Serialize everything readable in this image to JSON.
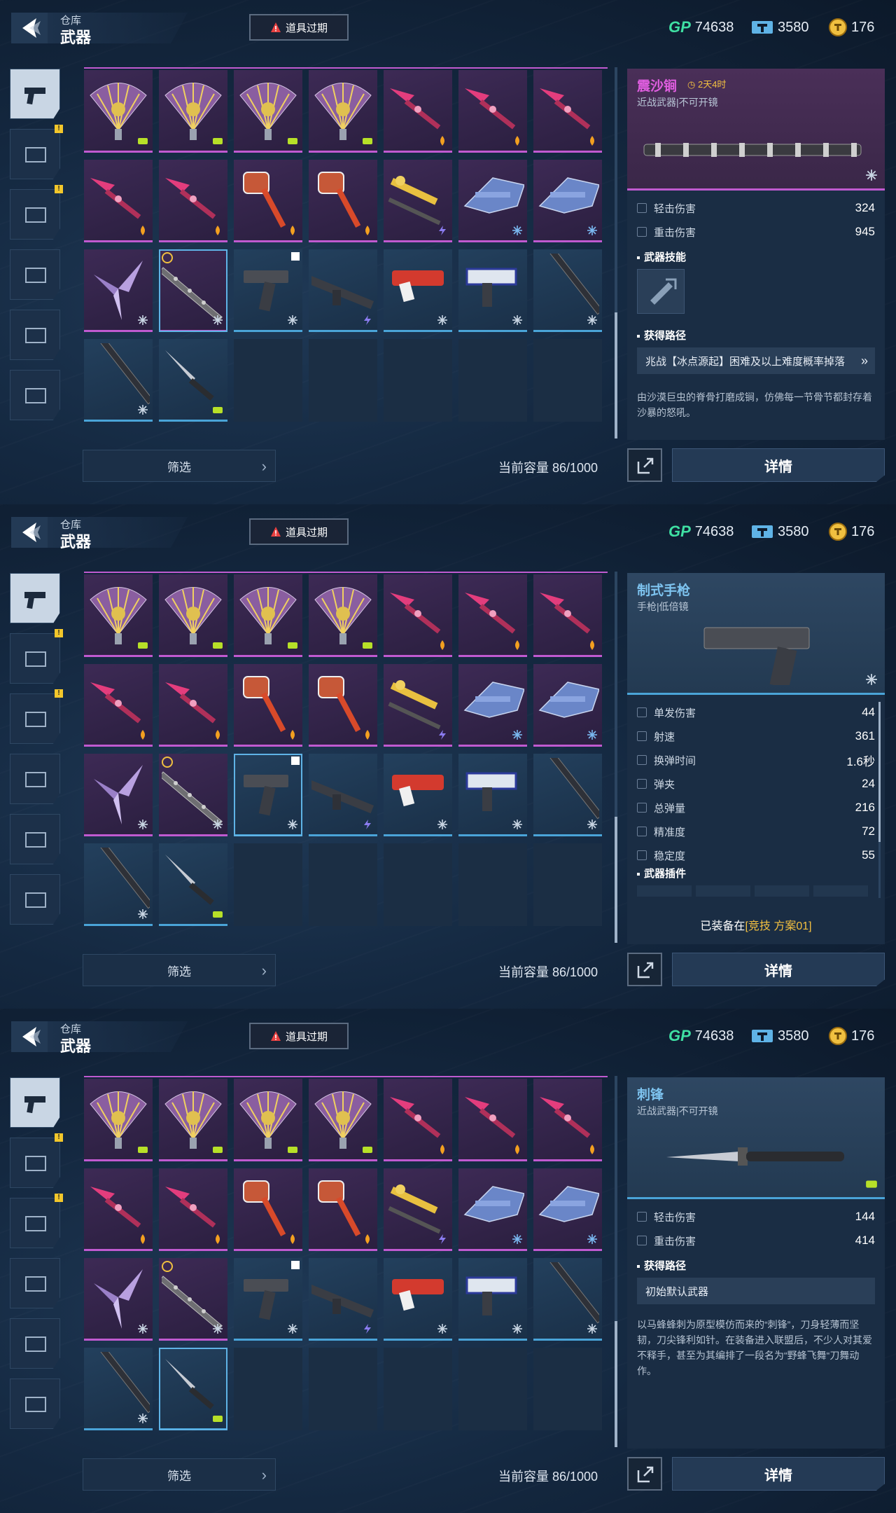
{
  "header": {
    "crumb": "仓库",
    "title": "武器",
    "expire_label": "道具过期"
  },
  "currency": {
    "gp_icon": "GP",
    "gp": "74638",
    "tickets": "3580",
    "coins": "176"
  },
  "footer": {
    "filter": "筛选",
    "capacity": "当前容量 86/1000",
    "details": "详情"
  },
  "colors": {
    "purple_rarity": "#c05ad0",
    "blue_rarity": "#4aa4d8",
    "gp": "#3fe0a3",
    "gold": "#f3c040"
  },
  "sidebar_icons": [
    "pistol-icon",
    "armor-icon",
    "helmet-icon",
    "gun-mod-icon",
    "tool-icon",
    "badge-icon"
  ],
  "panels": [
    {
      "selected_item": {
        "name": "震沙锏",
        "sub": "近战武器|不可开镜",
        "timer": "2天4时",
        "rarity": "purple",
        "stats": [
          {
            "label": "轻击伤害",
            "value": "324"
          },
          {
            "label": "重击伤害",
            "value": "945"
          }
        ],
        "skill_label": "武器技能",
        "path_label": "获得路径",
        "path": "兆战【冰点源起】困难及以上难度概率掉落",
        "desc": "由沙漠巨虫的脊骨打磨成锏，仿佛每一节骨节都封存着沙暴的怒吼。"
      }
    },
    {
      "selected_item": {
        "name": "制式手枪",
        "sub": "手枪|低倍镜",
        "rarity": "blue",
        "stats": [
          {
            "label": "单发伤害",
            "value": "44"
          },
          {
            "label": "射速",
            "value": "361"
          },
          {
            "label": "换弹时间",
            "value": "1.6秒"
          },
          {
            "label": "弹夹",
            "value": "24"
          },
          {
            "label": "总弹量",
            "value": "216"
          },
          {
            "label": "精准度",
            "value": "72"
          },
          {
            "label": "稳定度",
            "value": "55"
          }
        ],
        "plugin_label": "武器插件",
        "equip_prefix": "已装备在",
        "equip_loadout": "[竞技 方案01]"
      }
    },
    {
      "selected_item": {
        "name": "刺锋",
        "sub": "近战武器|不可开镜",
        "rarity": "blue",
        "stats": [
          {
            "label": "轻击伤害",
            "value": "144"
          },
          {
            "label": "重击伤害",
            "value": "414"
          }
        ],
        "path_label": "获得路径",
        "path": "初始默认武器",
        "desc": "以马蜂蜂刺为原型模仿而来的“刺锋”，刀身轻薄而坚韧，刀尖锋利如针。在装备进入联盟后，不少人对其爱不释手，甚至为其编排了一段名为“野蜂飞舞“刀舞动作。"
      }
    }
  ],
  "grid_items": [
    "fan",
    "fan",
    "fan",
    "fan",
    "spear",
    "spear",
    "spear",
    "spear",
    "spear",
    "hammer",
    "hammer",
    "gold-launcher",
    "crossbow",
    "crossbow",
    "wing-blade",
    "mace",
    "pistol",
    "rifle",
    "red-rifle",
    "smg",
    "baton",
    "baton",
    "knife",
    "",
    "",
    "",
    "",
    ""
  ]
}
